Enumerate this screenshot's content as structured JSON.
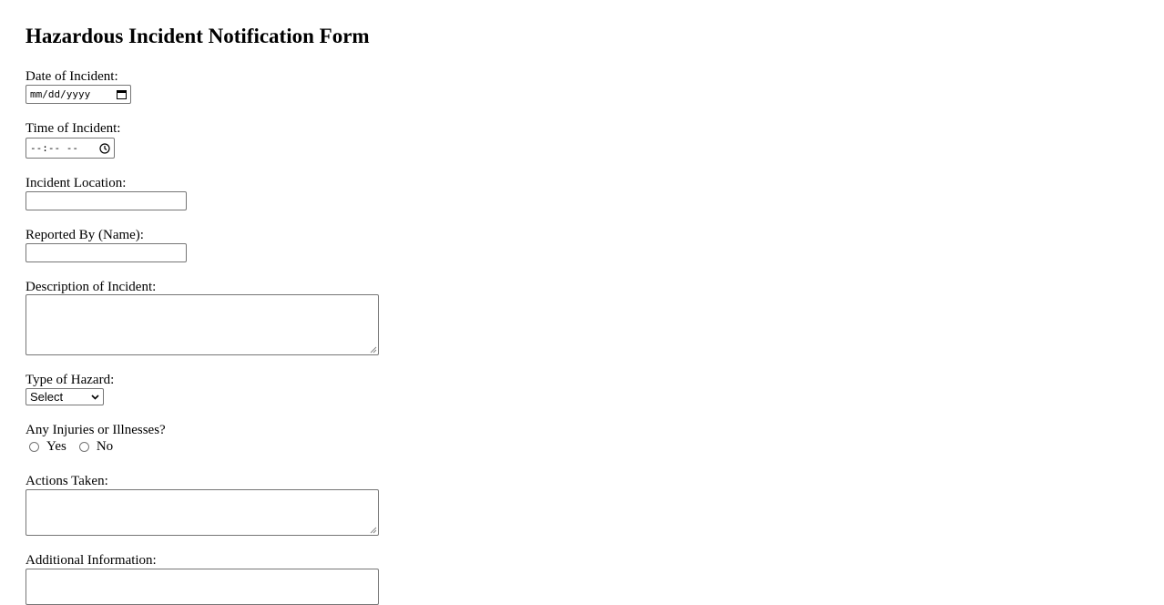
{
  "form": {
    "title": "Hazardous Incident Notification Form",
    "date": {
      "label": "Date of Incident:",
      "placeholder": "mm/dd/yyyy",
      "icon": "calendar-icon"
    },
    "time": {
      "label": "Time of Incident:",
      "placeholder": "--:-- --",
      "icon": "clock-icon"
    },
    "location": {
      "label": "Incident Location:",
      "value": ""
    },
    "reported_by": {
      "label": "Reported By (Name):",
      "value": ""
    },
    "description": {
      "label": "Description of Incident:",
      "value": ""
    },
    "hazard_type": {
      "label": "Type of Hazard:",
      "selected": "Select",
      "icon": "chevron-down-icon"
    },
    "injuries": {
      "label": "Any Injuries or Illnesses?",
      "options": [
        "Yes",
        "No"
      ]
    },
    "actions": {
      "label": "Actions Taken:",
      "value": ""
    },
    "additional": {
      "label": "Additional Information:",
      "value": ""
    }
  }
}
